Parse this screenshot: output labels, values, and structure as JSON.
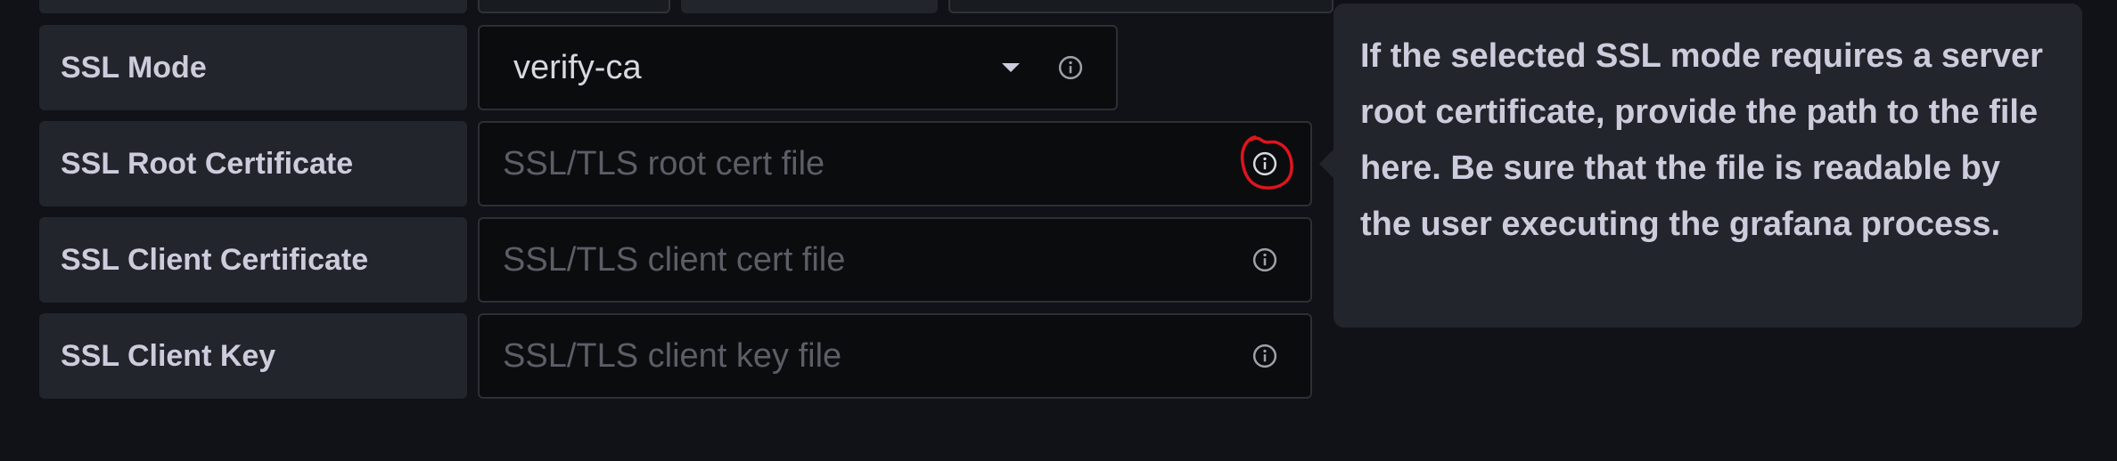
{
  "form": {
    "rows": [
      {
        "label": "SSL Mode",
        "value": "verify-ca"
      },
      {
        "label": "SSL Root Certificate",
        "placeholder": "SSL/TLS root cert file"
      },
      {
        "label": "SSL Client Certificate",
        "placeholder": "SSL/TLS client cert file"
      },
      {
        "label": "SSL Client Key",
        "placeholder": "SSL/TLS client key file"
      }
    ]
  },
  "tooltip": {
    "text": "If the selected SSL mode requires a server root certificate, provide the path to the file here. Be sure that the file is readable by the user executing the grafana process."
  },
  "icons": {
    "info": "info-icon",
    "dropdown": "chevron-down-icon"
  },
  "colors": {
    "background": "#111217",
    "label_bg": "#22252b",
    "input_bg": "#0b0c0e",
    "annotation": "#e0141e"
  }
}
